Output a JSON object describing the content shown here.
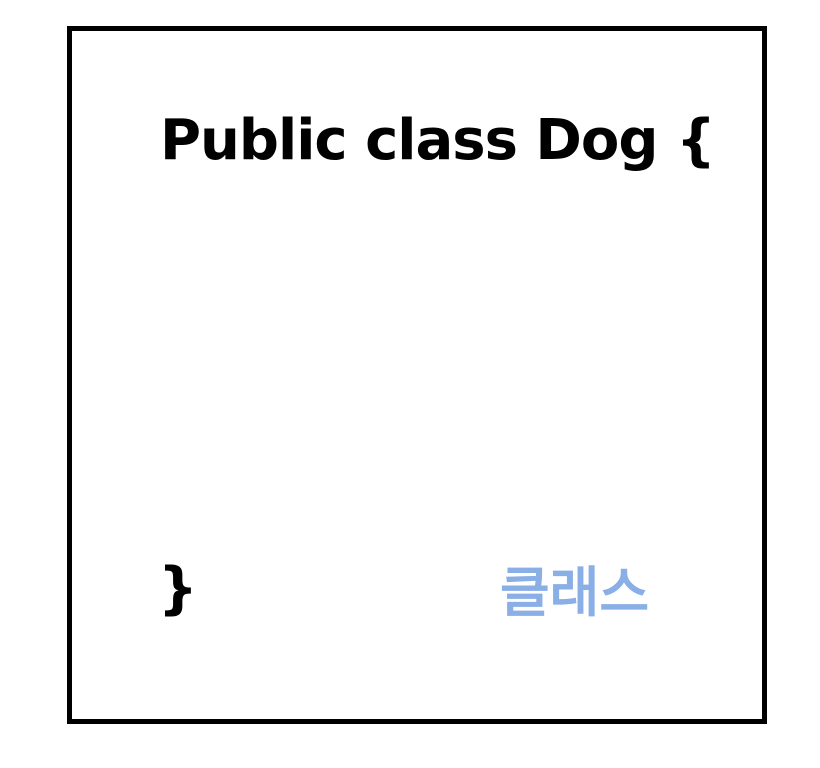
{
  "code": {
    "opening_line": "Public class Dog {",
    "closing_brace": "}"
  },
  "label": {
    "text": "클래스",
    "color": "#8aaee6"
  },
  "colors": {
    "frame_border": "#000000",
    "code_text": "#000000",
    "background": "#ffffff"
  }
}
